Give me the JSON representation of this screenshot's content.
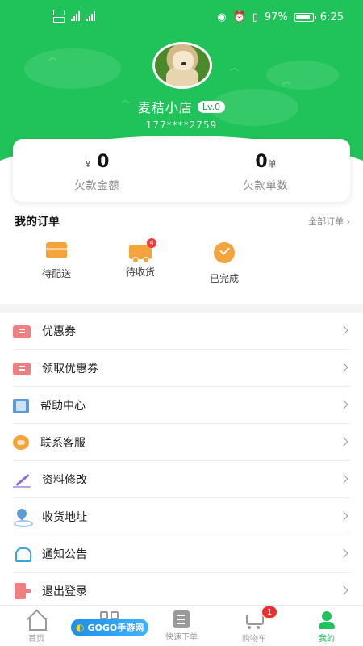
{
  "status_bar": {
    "battery": "97%",
    "time": "6:25",
    "sim_labels": [
      "4G",
      "4G"
    ]
  },
  "profile": {
    "shop_name": "麦秸小店",
    "level": "Lv.0",
    "phone": "177****2759"
  },
  "debt": {
    "amount_prefix": "¥",
    "amount": "0",
    "amount_label": "欠款金额",
    "count": "0",
    "count_unit": "单",
    "count_label": "欠款单数"
  },
  "orders": {
    "title": "我的订单",
    "all_label": "全部订单 ›",
    "items": [
      {
        "label": "待配送",
        "icon": "box-icon"
      },
      {
        "label": "待收货",
        "icon": "truck-icon",
        "badge": "4"
      },
      {
        "label": "已完成",
        "icon": "check-circle-icon"
      }
    ]
  },
  "menu": [
    {
      "label": "优惠券",
      "icon": "coupon-icon"
    },
    {
      "label": "领取优惠券",
      "icon": "coupon-icon"
    },
    {
      "label": "帮助中心",
      "icon": "help-book-icon"
    },
    {
      "label": "联系客服",
      "icon": "customer-service-icon"
    },
    {
      "label": "资料修改",
      "icon": "edit-pen-icon"
    },
    {
      "label": "收货地址",
      "icon": "location-pin-icon"
    },
    {
      "label": "通知公告",
      "icon": "bell-icon"
    },
    {
      "label": "退出登录",
      "icon": "logout-icon"
    }
  ],
  "tabbar": {
    "items": [
      {
        "label": "首页",
        "icon": "home-icon"
      },
      {
        "label": "",
        "icon": "category-icon"
      },
      {
        "label": "快速下单",
        "icon": "quick-order-icon"
      },
      {
        "label": "购物车",
        "icon": "cart-icon",
        "badge": "1"
      },
      {
        "label": "我的",
        "icon": "user-icon",
        "active": true
      }
    ]
  },
  "watermark": {
    "brand": "GOGO手游网"
  },
  "colors": {
    "primary": "#20c35a",
    "accent_orange": "#f4a43c",
    "badge_red": "#f02d2d"
  }
}
